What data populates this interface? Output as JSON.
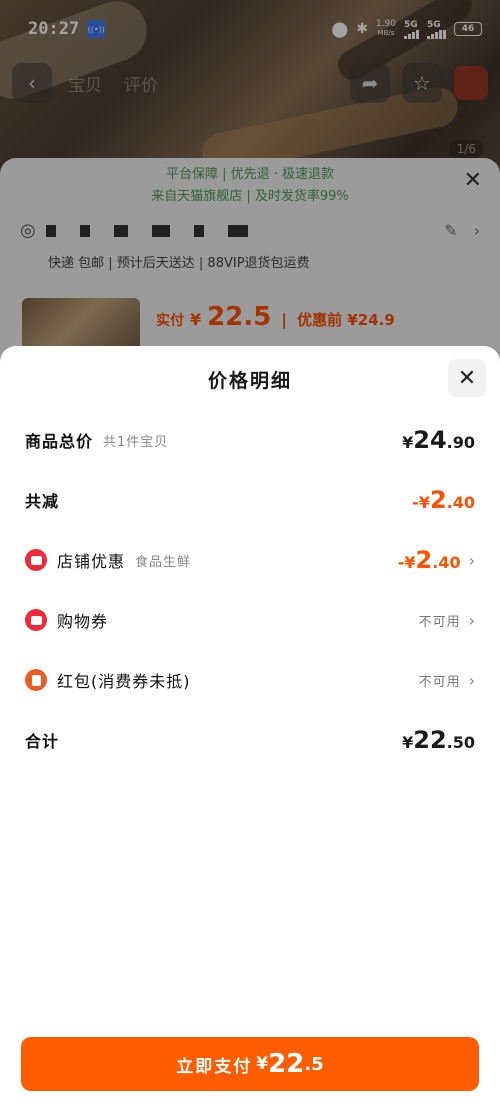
{
  "status_bar": {
    "time": "20:27",
    "network_speed": "1.90",
    "network_unit": "MB/s",
    "net_type_1": "5G",
    "net_type_2": "5G",
    "battery": "46"
  },
  "background_page": {
    "nav_tabs": [
      "宝贝",
      "评价"
    ],
    "pager": "1/6",
    "guarantee_line1": "平台保障 | 优先退 · 极速退款",
    "guarantee_line2": "来自天猫旗舰店 | 及时发货率99%",
    "shipping": "快递 包邮 | 预计后天送达 | 88VIP退货包运费",
    "pay_label": "实付",
    "pay_symbol": "¥",
    "pay_amount": "22.5",
    "before_label": "优惠前 ¥24.9"
  },
  "price_detail": {
    "title": "价格明细",
    "rows": {
      "subtotal": {
        "label": "商品总价",
        "sub": "共1件宝贝",
        "symbol": "¥",
        "int": "24",
        "dec": ".90"
      },
      "total_discount": {
        "label": "共减",
        "symbol": "-¥",
        "int": "2",
        "dec": ".40"
      },
      "store_discount": {
        "label": "店铺优惠",
        "sub": "食品生鲜",
        "symbol": "-¥",
        "int": "2",
        "dec": ".40"
      },
      "coupon": {
        "label": "购物券",
        "status": "不可用"
      },
      "red_packet": {
        "label": "红包(消费券未抵)",
        "status": "不可用"
      },
      "total": {
        "label": "合计",
        "symbol": "¥",
        "int": "22",
        "dec": ".50"
      }
    },
    "pay_button": {
      "label": "立即支付",
      "symbol": "¥",
      "int": "22",
      "dec": ".5"
    }
  }
}
